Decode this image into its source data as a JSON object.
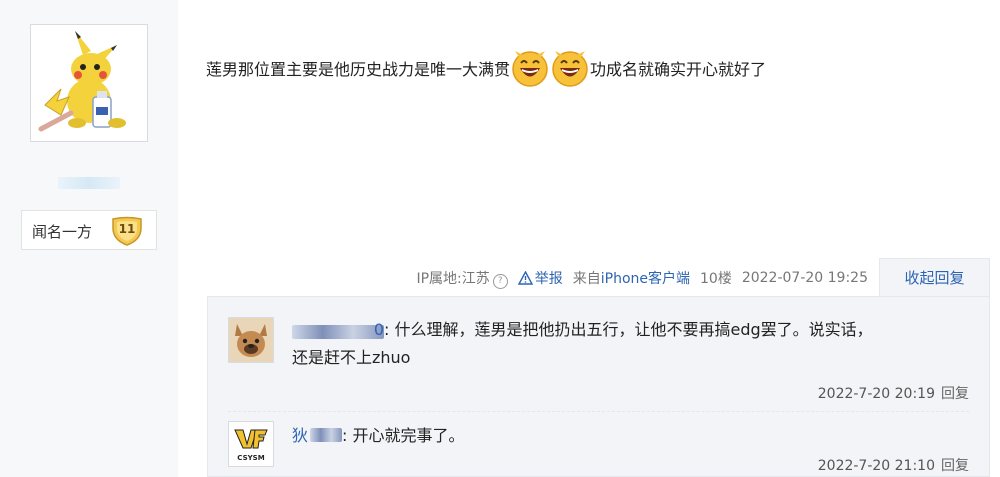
{
  "author": {
    "level_name": "闻名一方",
    "level_number": "11"
  },
  "post": {
    "text_before": "莲男那位置主要是他历史战力是唯一大满贯",
    "text_after": "功成名就确实开心就好了"
  },
  "meta": {
    "ip_location": "IP属地:江苏",
    "help_icon": "?",
    "report_label": "举报",
    "client_prefix": "来自",
    "client_name": "iPhone客户端",
    "floor": "10楼",
    "datetime": "2022-07-20 19:25",
    "collapse_label": "收起回复"
  },
  "replies": [
    {
      "name_suffix": "0",
      "text_line1": ": 什么理解，莲男是把他扔出五行，让他不要再搞edg罢了。说实话，",
      "text_line2": "还是赶不上zhuo",
      "time": "2022-7-20 20:19",
      "reply_label": "回复"
    },
    {
      "name_prefix": "狄",
      "text_line1": ": 开心就完事了。",
      "avatar_text": "CSYSM",
      "time": "2022-7-20 21:10",
      "reply_label": "回复"
    }
  ],
  "colors": {
    "link": "#2d64b3",
    "sidebar_bg": "#f7f8fa",
    "reply_bg": "#f2f4f7"
  }
}
